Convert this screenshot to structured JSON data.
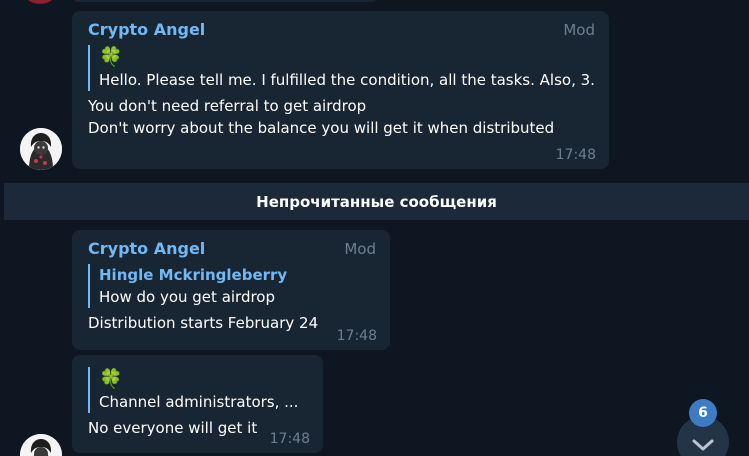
{
  "divider": {
    "unread_label": "Непрочитанные сообщения"
  },
  "messages": [
    {
      "sender": "Crypto Angel",
      "badge": "Mod",
      "reply_emoji": "🍀",
      "reply_text": "Hello. Please tell me. I fulfilled the condition, all the tasks. Also, 3...",
      "lines": [
        "You don't need referral to get airdrop",
        "Don't worry about the balance you will get it when distributed"
      ],
      "time": "17:48"
    },
    {
      "sender": "Crypto Angel",
      "badge": "Mod",
      "reply_author": "Hingle Mckringleberry",
      "reply_text": "How do you get airdrop",
      "text": "Distribution starts February 24",
      "time": "17:48"
    },
    {
      "reply_emoji": "🍀",
      "reply_text": "Channel administrators, ...",
      "text": "No everyone will get it",
      "time": "17:48"
    }
  ],
  "scroll": {
    "unread_count": "6",
    "icon": "chevron-down-icon"
  },
  "colors": {
    "background": "#0e1621",
    "bubble": "#182533",
    "accent": "#71b8f5",
    "muted": "#6d7f8f",
    "badge": "#3d7bc4"
  }
}
